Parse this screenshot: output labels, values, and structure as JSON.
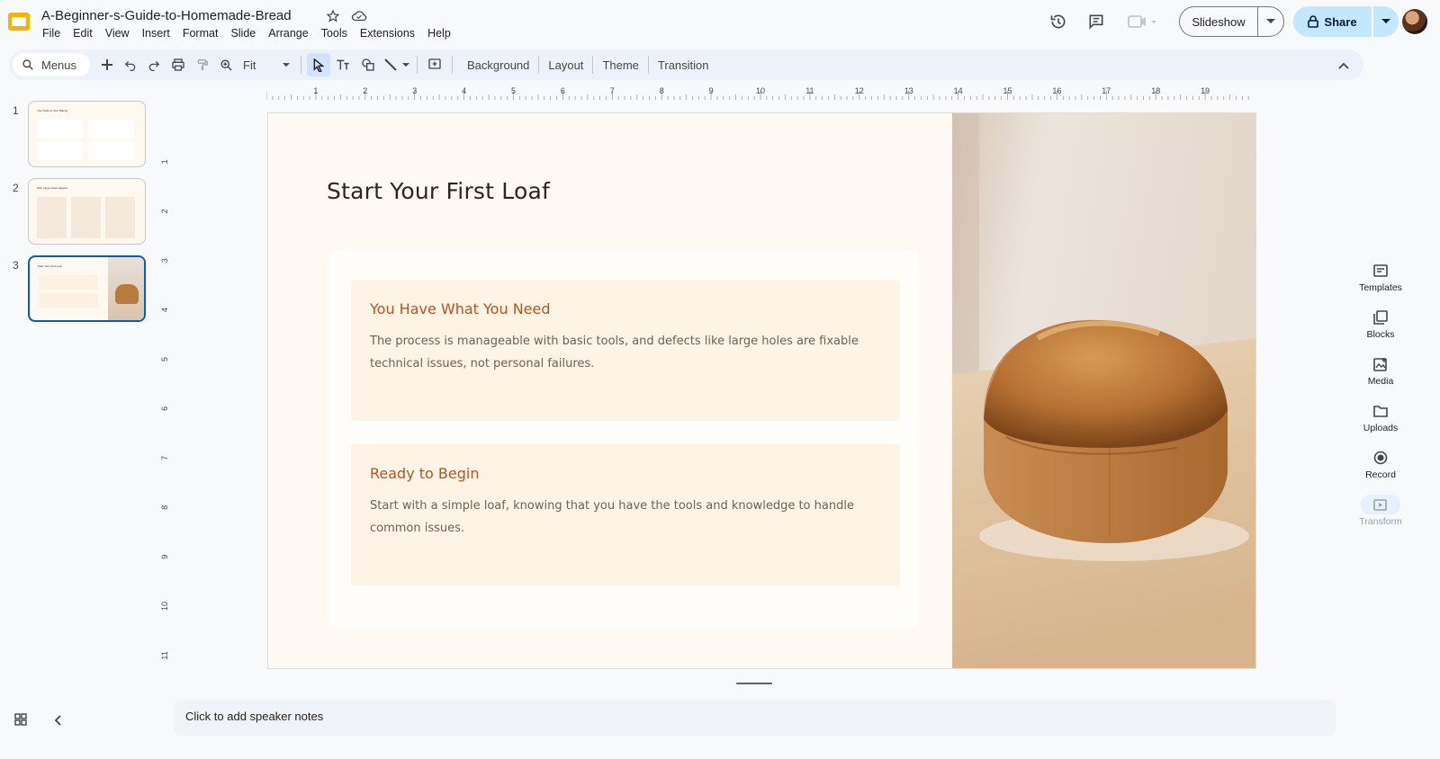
{
  "app": {
    "doc_title": "A-Beginner-s-Guide-to-Homemade-Bread",
    "menu": [
      "File",
      "Edit",
      "View",
      "Insert",
      "Format",
      "Slide",
      "Arrange",
      "Tools",
      "Extensions",
      "Help"
    ],
    "slideshow_label": "Slideshow",
    "share_label": "Share"
  },
  "toolbar": {
    "search_label": "Menus",
    "zoom_label": "Fit",
    "background_label": "Background",
    "layout_label": "Layout",
    "theme_label": "Theme",
    "transition_label": "Transition"
  },
  "ruler": {
    "h_ticks": [
      "1",
      "2",
      "3",
      "4",
      "5",
      "6",
      "7",
      "8",
      "9",
      "10",
      "11",
      "12",
      "13",
      "14",
      "15",
      "16",
      "17",
      "18",
      "19"
    ],
    "v_ticks": [
      "1",
      "2",
      "3",
      "4",
      "5",
      "6",
      "7",
      "8",
      "9",
      "10",
      "11"
    ]
  },
  "thumbnails": [
    {
      "num": "1",
      "title": "Your Tools to Your Baking"
    },
    {
      "num": "2",
      "title": "Why Large Holes Happen"
    },
    {
      "num": "3",
      "title": "Start Your First Loaf"
    }
  ],
  "slide": {
    "title": "Start Your First Loaf",
    "cards": [
      {
        "title": "You Have What You Need",
        "body": "The process is manageable with basic tools, and defects like large holes are fixable technical issues, not personal failures."
      },
      {
        "title": "Ready to Begin",
        "body": "Start with a simple loaf, knowing that you have the tools and knowledge to handle common issues."
      }
    ]
  },
  "side_panel": {
    "templates": "Templates",
    "blocks": "Blocks",
    "media": "Media",
    "uploads": "Uploads",
    "record": "Record",
    "transform": "Transform"
  },
  "notes_placeholder": "Click to add speaker notes",
  "colors": {
    "accent_blue": "#0b57d0",
    "share_bg": "#c2e7ff",
    "card_title": "#b3551f",
    "slide_bg": "#fefaf3"
  }
}
